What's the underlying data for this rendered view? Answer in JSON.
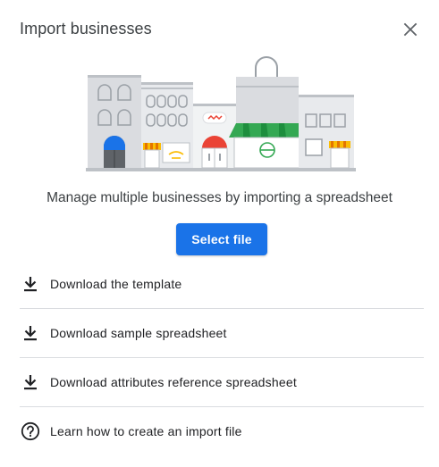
{
  "dialog": {
    "title": "Import businesses",
    "close_icon": "close-icon"
  },
  "illustration": {
    "name": "storefronts-illustration",
    "colors": {
      "gray_building": "#dadce0",
      "light_building": "#e8eaed",
      "blue_awning": "#1a73e8",
      "red_awning": "#ea4335",
      "yellow_awning": "#fbbc04",
      "green_awning": "#34a853"
    }
  },
  "tagline": "Manage multiple businesses by importing a spreadsheet",
  "select_file_label": "Select file",
  "accent_color": "#1a73e8",
  "links": [
    {
      "label": "Download the template",
      "icon": "download-icon"
    },
    {
      "label": "Download sample spreadsheet",
      "icon": "download-icon"
    },
    {
      "label": "Download attributes reference spreadsheet",
      "icon": "download-icon"
    },
    {
      "label": "Learn how to create an import file",
      "icon": "help-icon"
    }
  ]
}
